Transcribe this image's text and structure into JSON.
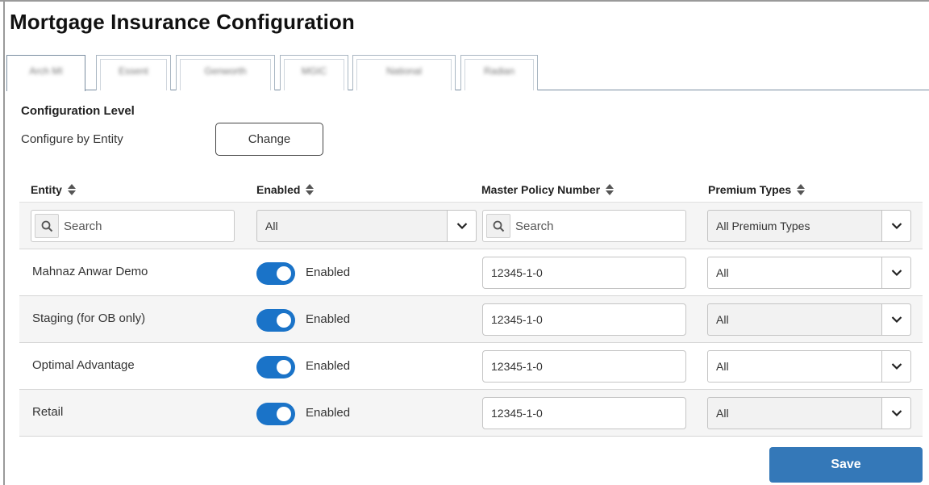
{
  "page": {
    "title": "Mortgage Insurance Configuration"
  },
  "tabs": [
    {
      "label": "Arch MI",
      "active": true
    },
    {
      "label": "Essent",
      "active": false
    },
    {
      "label": "Genworth",
      "active": false
    },
    {
      "label": "MGIC",
      "active": false
    },
    {
      "label": "National",
      "active": false
    },
    {
      "label": "Radian",
      "active": false
    }
  ],
  "config": {
    "heading": "Configuration Level",
    "label": "Configure by Entity",
    "change_label": "Change"
  },
  "table": {
    "columns": {
      "entity": "Entity",
      "enabled": "Enabled",
      "policy": "Master Policy Number",
      "premium": "Premium Types"
    },
    "filters": {
      "entity_placeholder": "Search",
      "enabled_value": "All",
      "policy_placeholder": "Search",
      "premium_value": "All Premium Types"
    },
    "rows": [
      {
        "entity": "Mahnaz Anwar Demo",
        "enabled": true,
        "enabled_label": "Enabled",
        "policy": "12345-1-0",
        "premium": "All"
      },
      {
        "entity": "Staging (for OB only)",
        "enabled": true,
        "enabled_label": "Enabled",
        "policy": "12345-1-0",
        "premium": "All"
      },
      {
        "entity": "Optimal Advantage",
        "enabled": true,
        "enabled_label": "Enabled",
        "policy": "12345-1-0",
        "premium": "All"
      },
      {
        "entity": "Retail",
        "enabled": true,
        "enabled_label": "Enabled",
        "policy": "12345-1-0",
        "premium": "All"
      }
    ]
  },
  "actions": {
    "save_label": "Save"
  },
  "colors": {
    "accent": "#1a73c8",
    "save": "#3478b8",
    "shaded_row": "#f5f5f5"
  },
  "icons": {
    "search": "search-icon",
    "dropdown": "chevron-down-icon",
    "sort": "sort-icon"
  }
}
